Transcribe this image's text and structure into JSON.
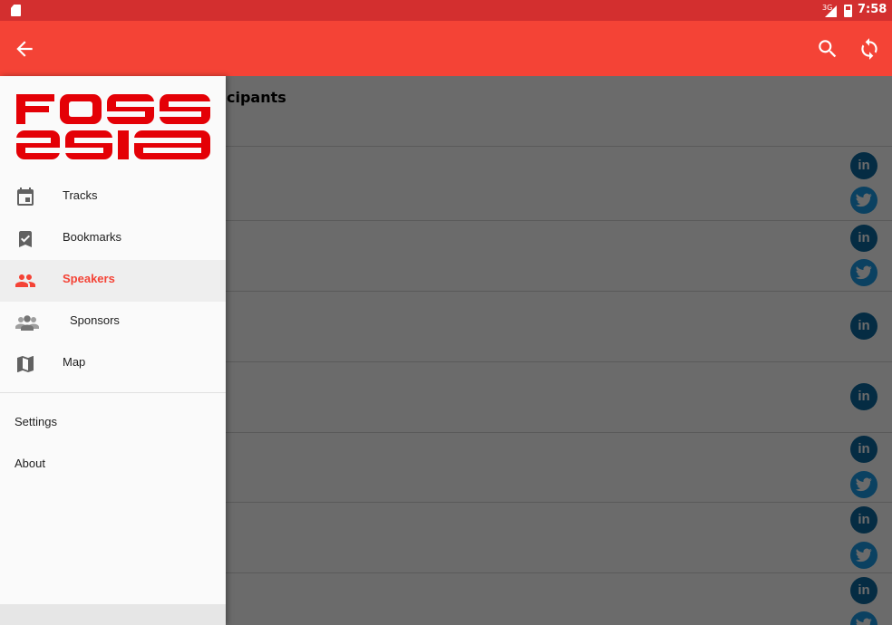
{
  "status_bar": {
    "network": "3G",
    "time": "7:58"
  },
  "app_bar": {
    "back_icon": "arrow-back-icon",
    "actions": [
      "search-icon",
      "refresh-icon"
    ]
  },
  "main": {
    "title_partial": "cipants",
    "rows": [
      {
        "icons": [
          "linkedin",
          "twitter"
        ]
      },
      {
        "icons": [
          "linkedin",
          "twitter"
        ]
      },
      {
        "icons": [
          "linkedin"
        ]
      },
      {
        "icons": [
          "linkedin"
        ]
      },
      {
        "icons": [
          "linkedin",
          "twitter"
        ]
      },
      {
        "icons": [
          "linkedin",
          "twitter"
        ]
      },
      {
        "icons": [
          "linkedin",
          "twitter"
        ]
      }
    ]
  },
  "drawer": {
    "logo_text": [
      "foss",
      "asia"
    ],
    "nav_items": [
      {
        "label": "Tracks",
        "icon": "calendar-icon"
      },
      {
        "label": "Bookmarks",
        "icon": "bookmark-check-icon"
      },
      {
        "label": "Speakers",
        "icon": "people-icon",
        "active": true
      },
      {
        "label": "Sponsors",
        "icon": "group-icon"
      },
      {
        "label": "Map",
        "icon": "map-icon"
      }
    ],
    "secondary_items": [
      {
        "label": "Settings"
      },
      {
        "label": "About"
      }
    ]
  },
  "colors": {
    "accent": "#f44336",
    "status_bar": "#d32f2f",
    "logo_red": "#e40006",
    "linkedin": "#0e6aa0",
    "twitter": "#1b9ce6"
  }
}
